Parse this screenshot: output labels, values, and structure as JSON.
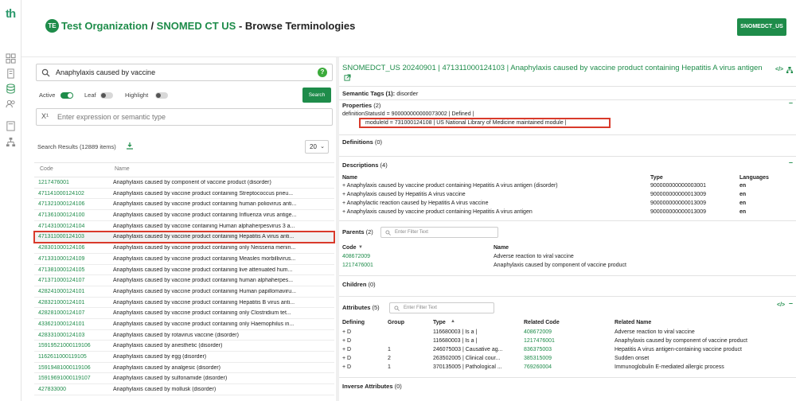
{
  "app": {
    "logo": "th"
  },
  "header": {
    "org_badge": "TE",
    "org": "Test Organization",
    "sep": " / ",
    "terminology": "SNOMED CT US",
    "dash": " - ",
    "page": "Browse Terminologies",
    "version_button": "SNOMEDCT_US"
  },
  "search": {
    "query": "Anaphylaxis caused by vaccine",
    "help": "?",
    "active_label": "Active",
    "leaf_label": "Leaf",
    "highlight_label": "Highlight",
    "search_button": "Search",
    "expr_icon": "X¹",
    "expr_placeholder": "Enter expression or semantic type",
    "results_label": "Search Results (12889 items)",
    "page_size": "20",
    "col_code": "Code",
    "col_name": "Name"
  },
  "results": [
    {
      "code": "1217476001",
      "name": "Anaphylaxis caused by component of vaccine product (disorder)"
    },
    {
      "code": "471141000124102",
      "name": "Anaphylaxis caused by vaccine product containing Streptococcus pneu..."
    },
    {
      "code": "471321000124106",
      "name": "Anaphylaxis caused by vaccine product containing human poliovirus anti..."
    },
    {
      "code": "471361000124100",
      "name": "Anaphylaxis caused by vaccine product containing Influenza virus antige..."
    },
    {
      "code": "471431000124104",
      "name": "Anaphylaxis caused by vaccine containing Human alphaherpesvirus 3 a..."
    },
    {
      "code": "471311000124103",
      "name": "Anaphylaxis caused by vaccine product containing Hepatitis A virus anti..."
    },
    {
      "code": "428301000124106",
      "name": "Anaphylaxis caused by vaccine product containing only Neisseria menin..."
    },
    {
      "code": "471331000124109",
      "name": "Anaphylaxis caused by vaccine product containing Measles morbillivirus..."
    },
    {
      "code": "471381000124105",
      "name": "Anaphylaxis caused by vaccine product containing live attenuated hum..."
    },
    {
      "code": "471371000124107",
      "name": "Anaphylaxis caused by vaccine product containing human alphaherpes..."
    },
    {
      "code": "428241000124101",
      "name": "Anaphylaxis caused by vaccine product containing Human papillomaviru..."
    },
    {
      "code": "428321000124101",
      "name": "Anaphylaxis caused by vaccine product containing Hepatitis B virus anti..."
    },
    {
      "code": "428281000124107",
      "name": "Anaphylaxis caused by vaccine product containing only Clostridium tet..."
    },
    {
      "code": "433621000124101",
      "name": "Anaphylaxis caused by vaccine product containing only Haemophilus in..."
    },
    {
      "code": "428331000124103",
      "name": "Anaphylaxis caused by rotavirus vaccine (disorder)"
    },
    {
      "code": "15919521000119106",
      "name": "Anaphylaxis caused by anesthetic (disorder)"
    },
    {
      "code": "1162611000119105",
      "name": "Anaphylaxis caused by egg (disorder)"
    },
    {
      "code": "15919481000119106",
      "name": "Anaphylaxis caused by analgesic (disorder)"
    },
    {
      "code": "15919691000119107",
      "name": "Anaphylaxis caused by sulfonamide (disorder)"
    },
    {
      "code": "427833000",
      "name": "Anaphylaxis caused by mollusk (disorder)"
    }
  ],
  "concept": {
    "title": "SNOMEDCT_US 20240901 | 471311000124103 | Anaphylaxis caused by vaccine product containing Hepatitis A virus antigen",
    "code_icon": "</>",
    "semantic_tags": "Semantic Tags (1):",
    "semantic_tags_value": "disorder",
    "properties_label": "Properties",
    "properties_count": "(2)",
    "prop1": "definitionStatusId   =   900000000000073002 | Defined |",
    "prop2": "moduleId   =   731000124108 | US National Library of Medicine maintained module |",
    "definitions_label": "Definitions",
    "definitions_count": "(0)",
    "descriptions_label": "Descriptions",
    "descriptions_count": "(4)",
    "desc_col_name": "Name",
    "desc_col_type": "Type",
    "desc_col_lang": "Languages",
    "descriptions": [
      {
        "name": "+ Anaphylaxis caused by vaccine product containing Hepatitis A virus antigen (disorder)",
        "type": "900000000000003001",
        "lang": "en"
      },
      {
        "name": "+ Anaphylaxis caused by Hepatitis A virus vaccine",
        "type": "900000000000013009",
        "lang": "en"
      },
      {
        "name": "+ Anaphylactic reaction caused by Hepatitis A virus vaccine",
        "type": "900000000000013009",
        "lang": "en"
      },
      {
        "name": "+ Anaphylaxis caused by vaccine product containing Hepatitis A virus antigen",
        "type": "900000000000013009",
        "lang": "en"
      }
    ],
    "parents_label": "Parents",
    "parents_count": "(2)",
    "filter_placeholder": "Enter Filter Text",
    "par_col_code": "Code",
    "par_col_name": "Name",
    "parents": [
      {
        "code": "408672009",
        "name": "Adverse reaction to viral vaccine"
      },
      {
        "code": "1217476001",
        "name": "Anaphylaxis caused by component of vaccine product"
      }
    ],
    "children_label": "Children",
    "children_count": "(0)",
    "attributes_label": "Attributes",
    "attributes_count": "(5)",
    "att_col_defining": "Defining",
    "att_col_group": "Group",
    "att_col_type": "Type",
    "att_col_related_code": "Related Code",
    "att_col_related_name": "Related Name",
    "attributes": [
      {
        "defining": "+ D",
        "group": "",
        "type": "116680003 | Is a |",
        "code": "408672009",
        "name": "Adverse reaction to viral vaccine"
      },
      {
        "defining": "+ D",
        "group": "",
        "type": "116680003 | Is a |",
        "code": "1217476001",
        "name": "Anaphylaxis caused by component of vaccine product"
      },
      {
        "defining": "+ D",
        "group": "1",
        "type": "246075003 | Causative ag...",
        "code": "836375003",
        "name": "Hepatitis A virus antigen-containing vaccine product"
      },
      {
        "defining": "+ D",
        "group": "2",
        "type": "263502005 | Clinical cour...",
        "code": "385315009",
        "name": "Sudden onset"
      },
      {
        "defining": "+ D",
        "group": "1",
        "type": "370135005 | Pathological ...",
        "code": "769260004",
        "name": "Immunoglobulin E-mediated allergic process"
      }
    ],
    "inverse_label": "Inverse Attributes",
    "inverse_count": "(0)"
  }
}
